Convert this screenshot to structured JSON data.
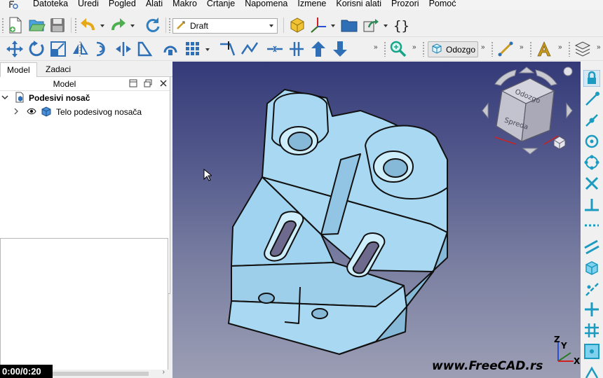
{
  "menubar": {
    "items": [
      "Datoteka",
      "Uredi",
      "Pogled",
      "Alati",
      "Makro",
      "Crtanje",
      "Napomena",
      "Izmene",
      "Korisni alati",
      "Prozori",
      "Pomoć"
    ]
  },
  "toolbar": {
    "workbench_selector": {
      "value": "Draft"
    },
    "view_button": {
      "label": "Odozgo"
    },
    "overflow_label": "»"
  },
  "left_panel": {
    "tabs": [
      "Model",
      "Zadaci"
    ],
    "tree_header": "Model",
    "tree": [
      {
        "label": "Podesivi nosač",
        "expanded": true,
        "bold": true
      },
      {
        "label": "Telo podesivog nosača",
        "expanded": false,
        "visible": true
      }
    ]
  },
  "navcube": {
    "faces": [
      "Odozgo",
      "Spreda"
    ]
  },
  "axis": {
    "x": "X",
    "y": "Y",
    "z": "Z"
  },
  "video": {
    "time": "0:00/0:20"
  },
  "watermark": "www.FreeCAD.rs",
  "colors": {
    "part_fill": "#a8d8f2",
    "part_shade": "#86b8d8",
    "accent_teal": "#1a9bbf",
    "viewport_top": "#343a78",
    "viewport_bottom": "#9c9eb4"
  }
}
